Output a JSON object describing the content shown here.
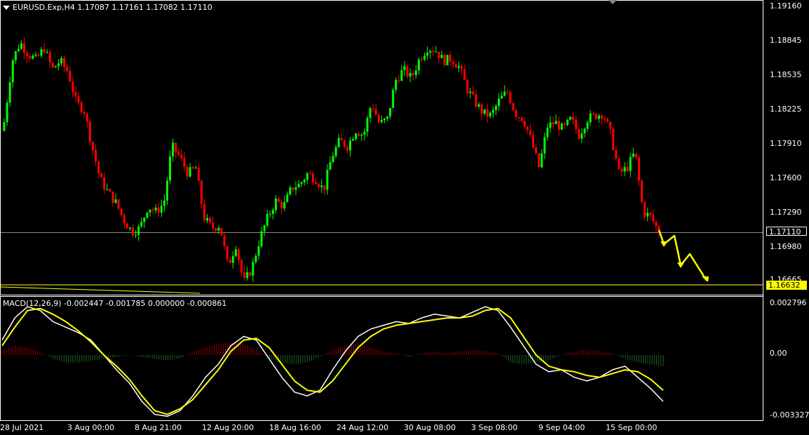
{
  "window": {
    "symbol_header": "EURUSD.Exp,H4  1.17087 1.17161 1.17082 1.17110",
    "macd_header": "MACD(12,26,9) -0.002447 -0.001785 0.000000 -0.000861"
  },
  "colors": {
    "background": "#000000",
    "bull_candle": "#00ff00",
    "bear_candle": "#ff0000",
    "macd_line": "#ffffff",
    "signal_line": "#ffff00",
    "hist_positive": "#8b0000",
    "hist_negative": "#1f5f1f",
    "support_line": "#ffff00",
    "current_price_line": "#8c8c8c",
    "grid_frame": "#ffffff"
  },
  "price_axis": {
    "ticks": [
      "1.19160",
      "1.18845",
      "1.18535",
      "1.18225",
      "1.17910",
      "1.17600",
      "1.17290",
      "1.16980",
      "1.16665"
    ],
    "current_price": "1.17110",
    "support_price": "1.16632"
  },
  "macd_axis": {
    "ticks": [
      "0.002796",
      "0.00",
      "-0.003327"
    ]
  },
  "time_axis": {
    "ticks": [
      "28 Jul 2021",
      "3 Aug 00:00",
      "8 Aug 21:00",
      "12 Aug 20:00",
      "18 Aug 16:00",
      "24 Aug 12:00",
      "30 Aug 08:00",
      "3 Sep 08:00",
      "9 Sep 04:00",
      "15 Sep 00:00"
    ]
  },
  "chart_data": [
    {
      "type": "candlestick",
      "title": "EURUSD.Exp,H4",
      "ylim": [
        1.16632,
        1.19185
      ],
      "close_path": [
        1.1812,
        1.1868,
        1.1885,
        1.1874,
        1.1869,
        1.188,
        1.186,
        1.1868,
        1.1858,
        1.183,
        1.1823,
        1.179,
        1.176,
        1.1748,
        1.1738,
        1.1722,
        1.1712,
        1.1715,
        1.1735,
        1.173,
        1.1738,
        1.179,
        1.178,
        1.1765,
        1.177,
        1.1725,
        1.1715,
        1.1718,
        1.168,
        1.17,
        1.1665,
        1.1678,
        1.1705,
        1.1725,
        1.174,
        1.1735,
        1.1752,
        1.1755,
        1.1765,
        1.176,
        1.175,
        1.178,
        1.1795,
        1.179,
        1.1805,
        1.18,
        1.183,
        1.181,
        1.1815,
        1.185,
        1.186,
        1.1852,
        1.187,
        1.188,
        1.1878,
        1.1868,
        1.187,
        1.1862,
        1.1842,
        1.183,
        1.182,
        1.1818,
        1.1832,
        1.184,
        1.182,
        1.1815,
        1.1795,
        1.177,
        1.1808,
        1.1812,
        1.1805,
        1.1815,
        1.18,
        1.1815,
        1.1818,
        1.182,
        1.18,
        1.1765,
        1.177,
        1.1785,
        1.173,
        1.1725,
        1.1711
      ],
      "current_price": 1.1711,
      "support_level": 1.16632,
      "annotation": "projected decline arrows toward support 1.16632"
    },
    {
      "type": "line",
      "title": "MACD(12,26,9)",
      "ylim": [
        -0.003327,
        0.002796
      ],
      "series": [
        {
          "values": [
            0.0008,
            0.002,
            0.0026,
            0.0024,
            0.0018,
            0.0015,
            0.0012,
            0.0008,
            0.0,
            -0.0008,
            -0.0015,
            -0.0025,
            -0.0032,
            -0.0033,
            -0.003,
            -0.0022,
            -0.0012,
            -0.0005,
            0.0005,
            0.001,
            0.0008,
            -0.0002,
            -0.0012,
            -0.002,
            -0.0022,
            -0.0019,
            -0.0008,
            0.0002,
            0.001,
            0.0014,
            0.0016,
            0.0018,
            0.0017,
            0.002,
            0.0022,
            0.0021,
            0.002,
            0.0023,
            0.0026,
            0.0024,
            0.0015,
            0.0005,
            -0.0005,
            -0.0009,
            -0.0008,
            -0.0012,
            -0.0014,
            -0.0012,
            -0.0008,
            -0.0006,
            -0.0012,
            -0.0018,
            -0.0025
          ]
        },
        {
          "values": [
            0.0005,
            0.0015,
            0.0024,
            0.0025,
            0.0022,
            0.0018,
            0.0013,
            0.0007,
            0.0,
            -0.0006,
            -0.0013,
            -0.0022,
            -0.003,
            -0.0032,
            -0.0029,
            -0.0024,
            -0.0016,
            -0.0008,
            0.0002,
            0.0008,
            0.0009,
            0.0004,
            -0.0005,
            -0.0014,
            -0.0019,
            -0.002,
            -0.0014,
            -0.0005,
            0.0004,
            0.001,
            0.0014,
            0.0016,
            0.0017,
            0.0018,
            0.0019,
            0.002,
            0.002,
            0.0021,
            0.0024,
            0.0025,
            0.002,
            0.001,
            0.0,
            -0.0006,
            -0.0008,
            -0.0009,
            -0.0011,
            -0.0012,
            -0.001,
            -0.0008,
            -0.0009,
            -0.0013,
            -0.0019
          ]
        }
      ],
      "histogram": [
        0.0003,
        0.0005,
        0.0004,
        0.0002,
        -0.0002,
        -0.0004,
        -0.0004,
        -0.0003,
        -0.0002,
        -0.0001,
        0.0,
        -0.0001,
        -0.0002,
        -0.0003,
        -0.0002,
        0.0002,
        0.0004,
        0.0006,
        0.0007,
        0.0006,
        0.0003,
        -0.0002,
        -0.0004,
        -0.0005,
        -0.0004,
        -0.0001,
        0.0003,
        0.0005,
        0.0006,
        0.0004,
        0.0002,
        0.0001,
        -0.0001,
        0.0001,
        0.0002,
        0.0001,
        0.0002,
        0.0003,
        0.0002,
        0.0001,
        -0.0004,
        -0.0005,
        -0.0004,
        -0.0003,
        0.0,
        0.0002,
        0.0003,
        0.0002,
        0.0001,
        -0.0002,
        -0.0004,
        -0.0005,
        -0.0006
      ]
    }
  ]
}
